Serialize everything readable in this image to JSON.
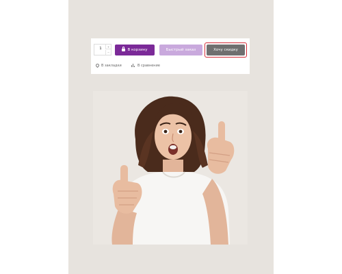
{
  "product_actions": {
    "quantity": {
      "value": "1",
      "increment_symbol": "+",
      "decrement_symbol": "−"
    },
    "add_to_cart_label": "В корзину",
    "quick_order_label": "Быстрый заказ",
    "discount_label": "Хочу скидку",
    "bookmarks_label": "В закладки",
    "compare_label": "В сравнение"
  },
  "colors": {
    "cart_button": "#7b2a98",
    "quick_order_button": "#c9a9dd",
    "discount_button": "#6f6f6f",
    "highlight_outline": "#d42a36",
    "panel_background": "#e7e3de"
  },
  "icons": {
    "cart_button": "lock-icon",
    "bookmarks": "heart-icon",
    "compare": "bar-chart-icon"
  },
  "illustration": {
    "subject": "surprised woman with thumb up and raised index finger"
  }
}
